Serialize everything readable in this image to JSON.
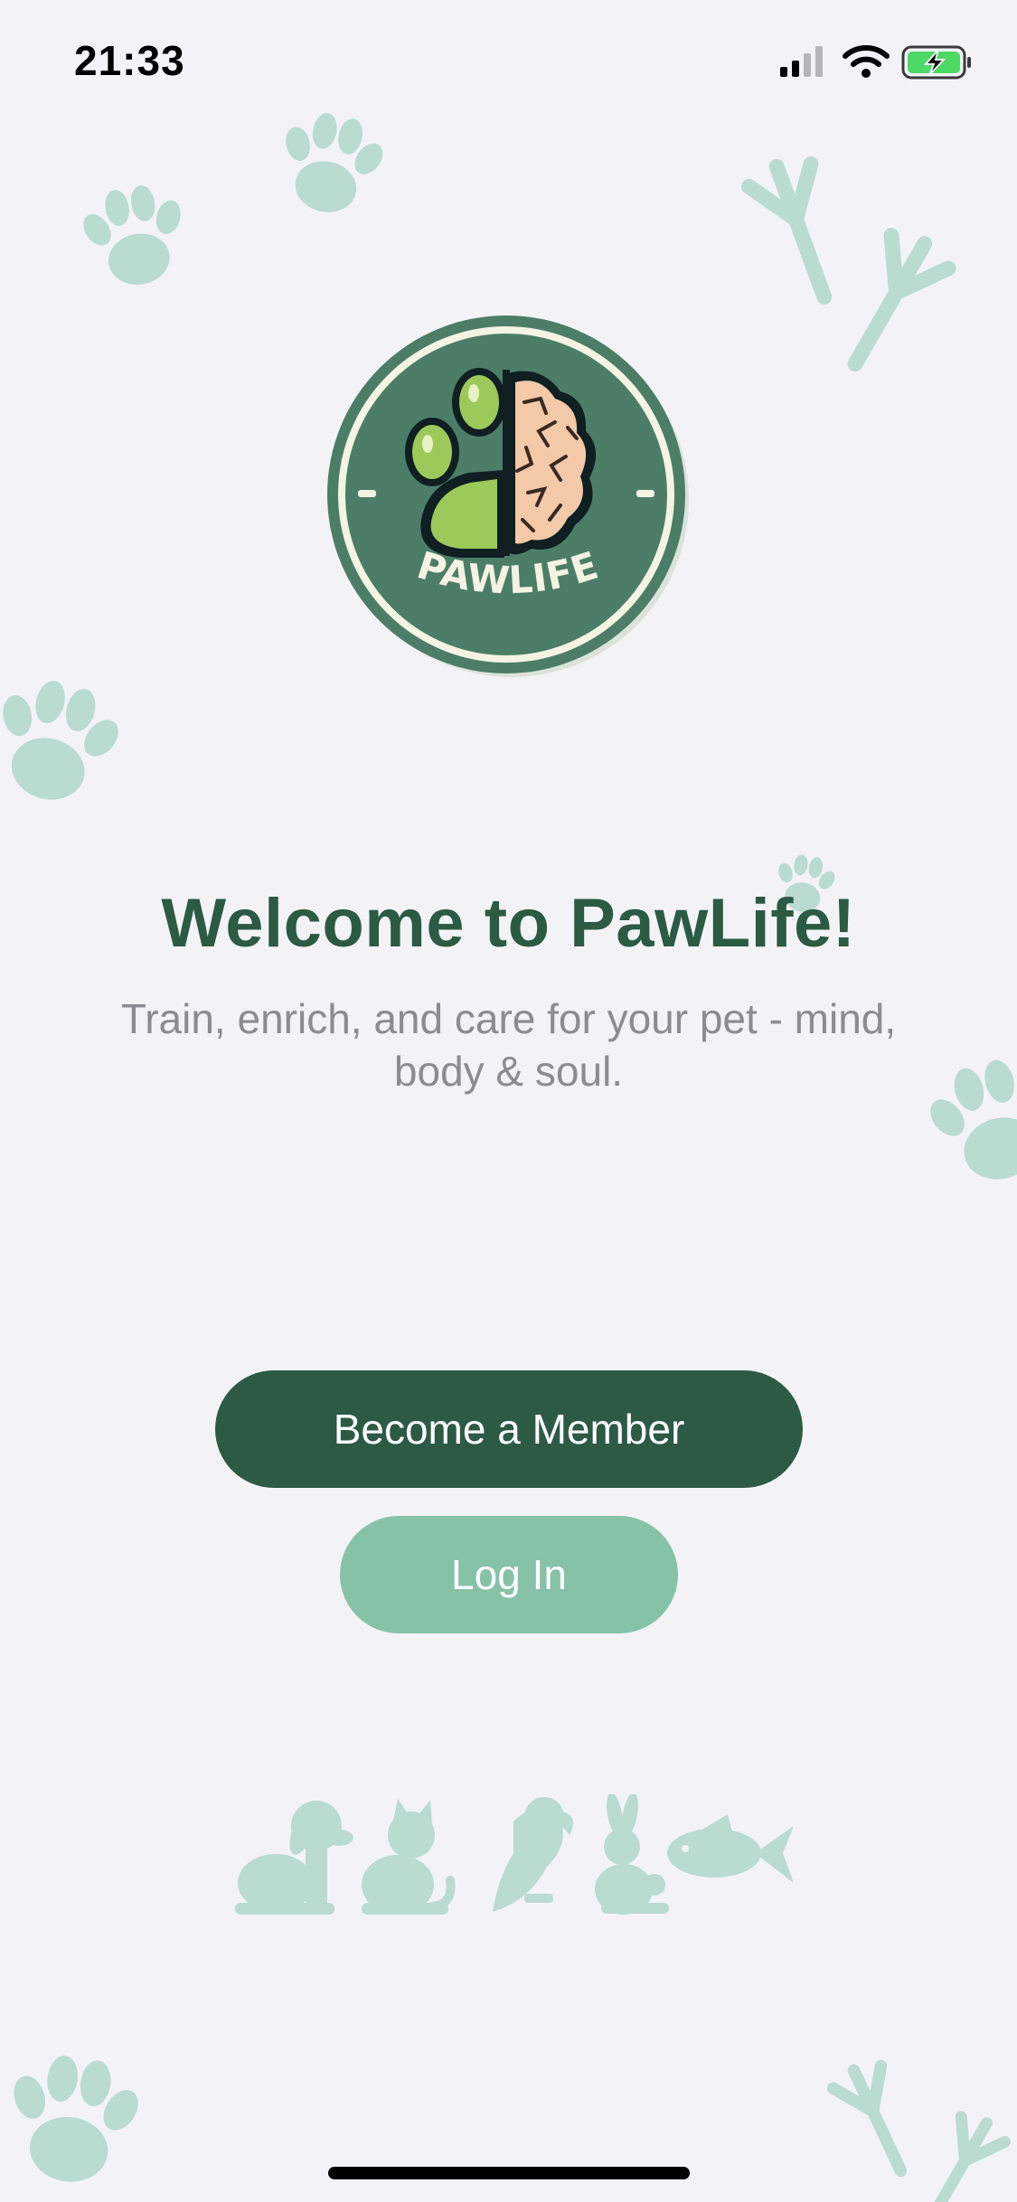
{
  "status_bar": {
    "time": "21:33",
    "icons": [
      "signal-icon",
      "wifi-icon",
      "battery-charging-icon"
    ]
  },
  "logo": {
    "text": "PAWLIFE",
    "icon": "paw-brain-logo"
  },
  "welcome": {
    "title": "Welcome to PawLife!",
    "subtitle": "Train, enrich, and care for your pet - mind, body & soul."
  },
  "actions": {
    "become_member_label": "Become a Member",
    "login_label": "Log In"
  },
  "decorations": {
    "pets": [
      "dog-icon",
      "cat-icon",
      "parrot-icon",
      "rabbit-icon",
      "fish-icon"
    ]
  },
  "colors": {
    "primary": "#2c5a45",
    "secondary": "#86c2a8",
    "decoration": "#b9dbd0",
    "background": "#f3f3f6",
    "subtitle": "#8b8b90"
  }
}
